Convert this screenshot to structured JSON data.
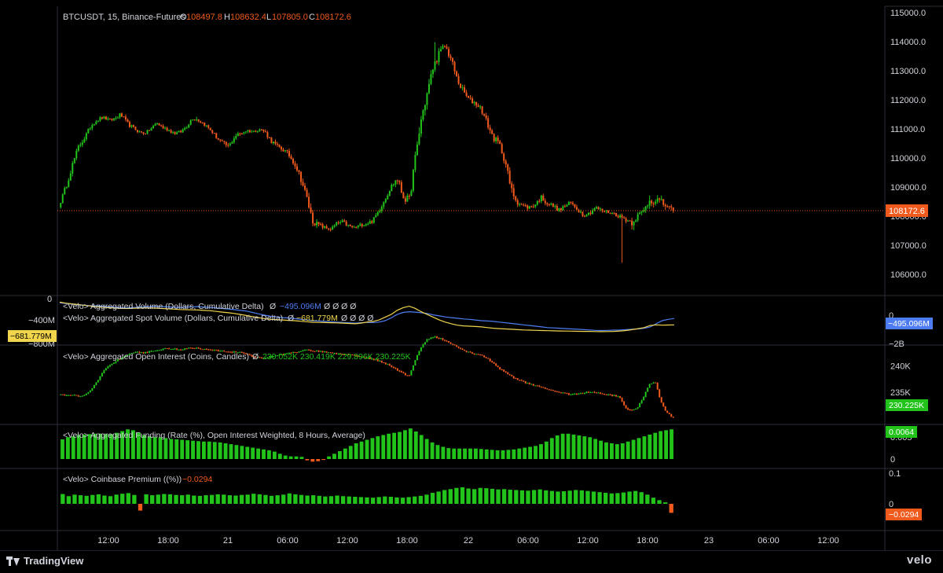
{
  "header": {
    "symbol": "BTCUSDT, 15, Binance-Futures",
    "open_label": "O",
    "open_value": "108497.8",
    "high_label": "H",
    "high_value": "108632.4",
    "low_label": "L",
    "low_value": "107805.0",
    "close_label": "C",
    "close_value": "108172.6"
  },
  "colors": {
    "up": "#22c31a",
    "down": "#f05a1c",
    "background": "#000000",
    "grid": "#2a2e39",
    "text": "#d1d4dc",
    "blue": "#4d7cf2",
    "yellow": "#f0d44c"
  },
  "x_axis": {
    "labels": [
      "12:00",
      "18:00",
      "21",
      "06:00",
      "12:00",
      "18:00",
      "22",
      "06:00",
      "12:00",
      "18:00",
      "23",
      "06:00",
      "12:00"
    ]
  },
  "indicators": {
    "cvd_agg": {
      "label": "<Velo> Aggregated Volume (Dollars, Cumulative Delta)",
      "symbol": "Ø",
      "value": "−495.096M",
      "trailing": "Ø  Ø  Ø  Ø"
    },
    "cvd_spot": {
      "label": "<Velo> Aggregated Spot Volume (Dollars, Cumulative Delta)",
      "symbol": "Ø",
      "value": "−681.779M",
      "trailing": "Ø  Ø  Ø  Ø"
    },
    "open_interest": {
      "label": "<Velo> Aggregated Open Interest (Coins, Candles)",
      "symbol": "Ø",
      "values": "230.052K  230.419K  229.896K  230.225K"
    },
    "funding": {
      "label": "<Velo> Aggregated Funding (Rate (%), Open Interest Weighted, 8 Hours, Average)"
    },
    "premium": {
      "label": "<Velo> Coinbase Premium ((%))",
      "value": "−0.0294"
    }
  },
  "badges": {
    "price": "108172.6",
    "cvd_left": "−681.779M",
    "cvd_right": "−495.096M",
    "oi": "230.225K",
    "funding": "0.0064",
    "premium": "−0.0294"
  },
  "footer": {
    "brand": "TradingView",
    "velo": "velo"
  },
  "chart_data": [
    {
      "type": "candlestick",
      "title": "BTCUSDT, 15, Binance-Futures",
      "interval": "15",
      "y_ticks": [
        115000,
        114000,
        113000,
        112000,
        111000,
        110000,
        109000,
        108000,
        107000,
        106000
      ],
      "ylim": [
        105400,
        115200
      ],
      "last_price": 108172.6,
      "path_close": [
        108500,
        109100,
        109800,
        110400,
        110700,
        111100,
        111300,
        111400,
        111300,
        111350,
        111500,
        111200,
        111050,
        110900,
        110850,
        111000,
        111200,
        111050,
        110950,
        110850,
        110900,
        111100,
        111400,
        111300,
        111150,
        110950,
        110700,
        110500,
        110400,
        110750,
        110850,
        110950,
        110900,
        111000,
        110900,
        110600,
        110400,
        110300,
        110100,
        109800,
        109300,
        108600,
        107800,
        107700,
        107600,
        107550,
        107750,
        107800,
        107650,
        107600,
        107700,
        107750,
        107850,
        108200,
        108600,
        109000,
        109300,
        108700,
        108500,
        109900,
        111300,
        112200,
        113100,
        113600,
        113850,
        113400,
        112700,
        112300,
        112000,
        111900,
        111700,
        111200,
        110700,
        110500,
        109900,
        108900,
        108500,
        108350,
        108300,
        108400,
        108650,
        108450,
        108350,
        108200,
        108350,
        108450,
        108250,
        108050,
        108100,
        108300,
        108200,
        108150,
        108100,
        108000,
        107900,
        107800,
        108000,
        108150,
        108550,
        108600,
        108450,
        108350,
        108172
      ],
      "path_range": [
        100,
        180,
        160,
        170,
        140,
        120,
        110,
        100,
        90,
        110,
        130,
        140,
        100,
        90,
        80,
        90,
        120,
        100,
        90,
        80,
        90,
        120,
        150,
        130,
        110,
        100,
        120,
        140,
        130,
        150,
        120,
        100,
        90,
        100,
        120,
        140,
        150,
        140,
        160,
        170,
        220,
        260,
        170,
        130,
        110,
        100,
        110,
        120,
        110,
        100,
        100,
        110,
        130,
        150,
        160,
        170,
        240,
        300,
        260,
        380,
        350,
        300,
        260,
        220,
        180,
        210,
        220,
        190,
        170,
        160,
        170,
        200,
        190,
        180,
        230,
        280,
        180,
        150,
        140,
        140,
        150,
        150,
        130,
        130,
        140,
        150,
        140,
        130,
        120,
        130,
        120,
        110,
        110,
        120,
        130,
        280,
        200,
        170,
        300,
        320,
        260,
        180,
        130
      ],
      "notable_extremes": {
        "high": 113980,
        "low": 106400
      }
    },
    {
      "type": "line",
      "title": "Cumulative Delta",
      "series": [
        {
          "name": "<Velo> Aggregated Volume (Dollars, Cumulative Delta)",
          "color": "#4d7cf2",
          "last": -495096000,
          "values": [
            -40,
            -60,
            -80,
            -100,
            -110,
            -120,
            -130,
            -140,
            -150,
            -165,
            -180,
            -190,
            -180,
            -170,
            -160,
            -150,
            -140,
            -150,
            -160,
            -170,
            -175,
            -165,
            -155,
            -150,
            -165,
            -175,
            -190,
            -205,
            -220,
            -240,
            -260,
            -280,
            -320,
            -360,
            -400,
            -430,
            -450,
            -470,
            -480,
            -500,
            -520,
            -540,
            -560,
            -570,
            -580,
            -590,
            -600,
            -610,
            -620,
            -630,
            -620,
            -610,
            -615,
            -600,
            -560,
            -480,
            -380,
            -320,
            -300,
            -310,
            -330,
            -350,
            -390,
            -420,
            -450,
            -470,
            -490,
            -510,
            -520,
            -540,
            -560,
            -570,
            -580,
            -600,
            -620,
            -640,
            -660,
            -680,
            -700,
            -720,
            -740,
            -760,
            -770,
            -780,
            -790,
            -800,
            -810,
            -820,
            -830,
            -840,
            -845,
            -840,
            -835,
            -830,
            -820,
            -810,
            -800,
            -780,
            -740,
            -650,
            -560,
            -520,
            -495
          ]
        },
        {
          "name": "<Velo> Aggregated Spot Volume (Dollars, Cumulative Delta)",
          "color": "#f0d44c",
          "last": -681779000,
          "values": [
            -20,
            -50,
            -70,
            -90,
            -110,
            -130,
            -150,
            -165,
            -180,
            -190,
            -200,
            -205,
            -200,
            -195,
            -190,
            -190,
            -195,
            -205,
            -215,
            -225,
            -235,
            -240,
            -245,
            -250,
            -260,
            -270,
            -290,
            -310,
            -330,
            -350,
            -380,
            -410,
            -440,
            -470,
            -500,
            -520,
            -530,
            -540,
            -550,
            -560,
            -575,
            -590,
            -605,
            -610,
            -615,
            -620,
            -625,
            -630,
            -640,
            -650,
            -630,
            -600,
            -580,
            -540,
            -460,
            -380,
            -260,
            -180,
            -140,
            -200,
            -300,
            -380,
            -460,
            -540,
            -600,
            -650,
            -690,
            -710,
            -720,
            -730,
            -740,
            -760,
            -780,
            -790,
            -800,
            -810,
            -820,
            -830,
            -835,
            -840,
            -845,
            -850,
            -855,
            -860,
            -862,
            -865,
            -868,
            -870,
            -872,
            -875,
            -878,
            -876,
            -870,
            -860,
            -845,
            -820,
            -790,
            -760,
            -700,
            -680,
            -690,
            -685,
            -681.8
          ]
        }
      ],
      "y_ticks": [
        "0",
        "−400M",
        "−800M",
        "−2B"
      ]
    },
    {
      "type": "candlestick",
      "title": "<Velo> Aggregated Open Interest (Coins, Candles)",
      "y_ticks": [
        240000,
        235000
      ],
      "path_close": [
        234600,
        234400,
        234500,
        234300,
        234400,
        235500,
        237000,
        238800,
        240000,
        240800,
        241500,
        242000,
        242400,
        242600,
        242500,
        242700,
        243000,
        243200,
        243300,
        243200,
        243100,
        243300,
        243400,
        243300,
        243100,
        243000,
        242900,
        242800,
        242700,
        242600,
        242500,
        242200,
        241800,
        241500,
        241600,
        241800,
        242000,
        242200,
        242400,
        242600,
        242800,
        243000,
        242900,
        242800,
        242600,
        242400,
        242300,
        242200,
        242100,
        242000,
        241700,
        241500,
        241300,
        240900,
        240500,
        240000,
        239300,
        238600,
        238000,
        241000,
        243500,
        245000,
        245500,
        245300,
        244800,
        244200,
        243600,
        243000,
        242500,
        242200,
        242000,
        241500,
        240500,
        239500,
        238800,
        238000,
        237500,
        237000,
        236600,
        236300,
        236000,
        235600,
        235300,
        235000,
        234800,
        234600,
        234700,
        234900,
        235100,
        235000,
        234800,
        234600,
        234400,
        234200,
        232000,
        231500,
        232000,
        234000,
        236500,
        237000,
        233000,
        231000,
        230225
      ],
      "last": 230225
    },
    {
      "type": "bar",
      "title": "<Velo> Aggregated Funding (Rate (%), Open Interest Weighted, 8 Hours, Average)",
      "y_ticks": [
        "0.005",
        "0"
      ],
      "last": 0.0064,
      "values": [
        0.0045,
        0.005,
        0.0052,
        0.0055,
        0.0056,
        0.0057,
        0.0058,
        0.0058,
        0.0057,
        0.0057,
        0.006,
        0.0064,
        0.0068,
        0.0066,
        0.006,
        0.0055,
        0.0052,
        0.005,
        0.005,
        0.0048,
        0.0046,
        0.0045,
        0.0044,
        0.0043,
        0.0042,
        0.0041,
        0.004,
        0.004,
        0.0039,
        0.0038,
        0.0036,
        0.0034,
        0.0032,
        0.003,
        0.0028,
        0.0026,
        0.0024,
        0.0022,
        0.002,
        0.0017,
        0.0012,
        0.0008,
        0.0006,
        0.0006,
        0.0005,
        -0.0003,
        -0.0006,
        -0.0005,
        -0.0002,
        0.0006,
        0.0012,
        0.0018,
        0.0024,
        0.003,
        0.0036,
        0.004,
        0.0044,
        0.0048,
        0.0052,
        0.0055,
        0.0058,
        0.006,
        0.0062,
        0.0066,
        0.007,
        0.0063,
        0.0055,
        0.0046,
        0.0038,
        0.0032,
        0.0028,
        0.0025,
        0.0024,
        0.0024,
        0.0024,
        0.0024,
        0.0024,
        0.0023,
        0.0022,
        0.0021,
        0.002,
        0.002,
        0.0021,
        0.0022,
        0.0024,
        0.0026,
        0.0028,
        0.003,
        0.0034,
        0.004,
        0.0048,
        0.0054,
        0.0058,
        0.0058,
        0.0056,
        0.0054,
        0.0052,
        0.005,
        0.0046,
        0.0042,
        0.0038,
        0.0036,
        0.0034,
        0.0036,
        0.004,
        0.0044,
        0.0048,
        0.0052,
        0.0056,
        0.006,
        0.0064,
        0.0066,
        0.0068
      ]
    },
    {
      "type": "bar",
      "title": "<Velo> Coinbase Premium ((%))",
      "y_ticks": [
        "0.1",
        "0"
      ],
      "last": -0.0294,
      "values": [
        0.032,
        0.025,
        0.03,
        0.028,
        0.026,
        0.029,
        0.031,
        0.027,
        0.025,
        0.03,
        0.033,
        0.035,
        0.029,
        -0.022,
        0.031,
        0.028,
        0.03,
        0.032,
        0.031,
        0.029,
        0.028,
        0.03,
        0.027,
        0.026,
        0.028,
        0.029,
        0.031,
        0.03,
        0.028,
        0.027,
        0.029,
        0.03,
        0.033,
        0.031,
        0.029,
        0.026,
        0.028,
        0.03,
        0.034,
        0.031,
        0.029,
        0.027,
        0.028,
        0.026,
        0.024,
        0.025,
        0.027,
        0.025,
        0.024,
        0.023,
        0.022,
        0.021,
        0.02,
        0.022,
        0.024,
        0.023,
        0.021,
        0.02,
        0.022,
        0.024,
        0.026,
        0.03,
        0.036,
        0.04,
        0.045,
        0.048,
        0.052,
        0.054,
        0.05,
        0.048,
        0.052,
        0.051,
        0.049,
        0.047,
        0.048,
        0.046,
        0.045,
        0.044,
        0.043,
        0.045,
        0.047,
        0.044,
        0.042,
        0.04,
        0.041,
        0.043,
        0.045,
        0.044,
        0.042,
        0.04,
        0.038,
        0.036,
        0.034,
        0.035,
        0.037,
        0.04,
        0.042,
        0.038,
        0.03,
        0.02,
        0.012,
        0.005,
        -0.0294
      ]
    }
  ]
}
